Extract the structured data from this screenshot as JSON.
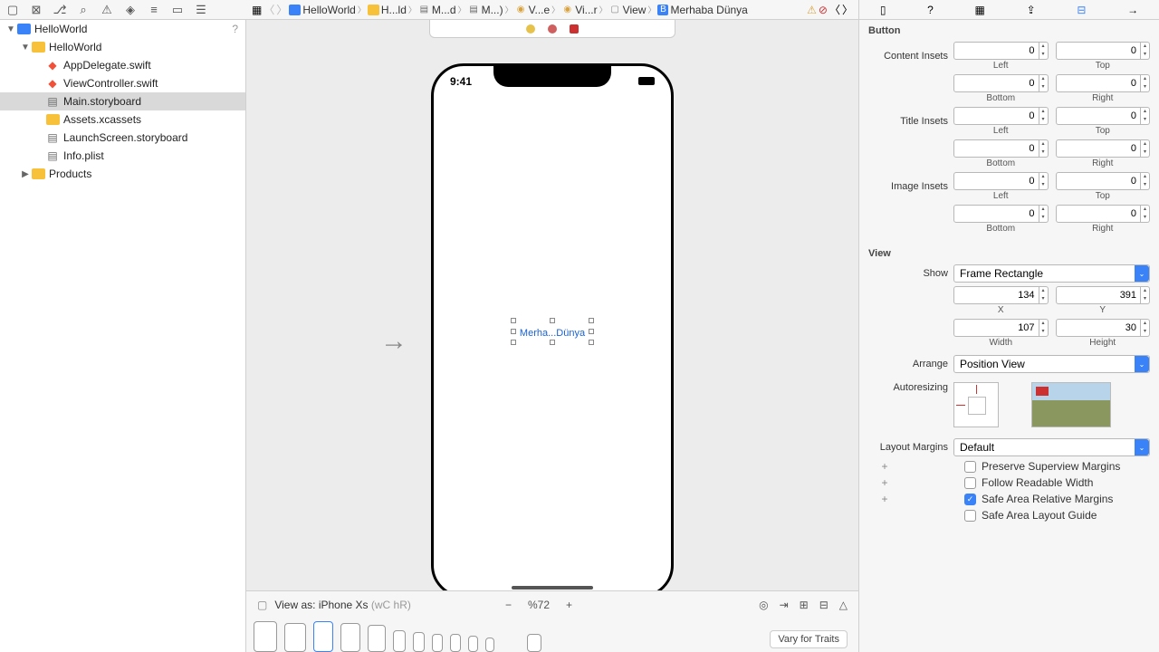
{
  "toolbar_icons": [
    "folder",
    "x-square",
    "branch",
    "search",
    "warn",
    "tag",
    "list",
    "flag",
    "chat"
  ],
  "right_icons": [
    "doc",
    "help",
    "grid",
    "pin",
    "ruler",
    "arrow"
  ],
  "jump_bar": {
    "nav_icons": [
      "grid",
      "back",
      "forward"
    ],
    "segments": [
      {
        "icon": "blue",
        "label": "HelloWorld"
      },
      {
        "icon": "yellow",
        "label": "H...ld"
      },
      {
        "icon": "sb",
        "label": "M...d"
      },
      {
        "icon": "sb",
        "label": "M...)"
      },
      {
        "icon": "scene",
        "label": "V...e"
      },
      {
        "icon": "vc",
        "label": "Vi...r"
      },
      {
        "icon": "view",
        "label": "View"
      },
      {
        "icon": "btn",
        "label": "Merhaba Dünya"
      }
    ],
    "err_icons": [
      "warn",
      "err"
    ]
  },
  "navigator": {
    "root": "HelloWorld",
    "help": "?",
    "items": [
      {
        "indent": 1,
        "icon": "yellow",
        "label": "HelloWorld",
        "disclosure": "▼"
      },
      {
        "indent": 2,
        "icon": "swift",
        "label": "AppDelegate.swift"
      },
      {
        "indent": 2,
        "icon": "swift",
        "label": "ViewController.swift"
      },
      {
        "indent": 2,
        "icon": "sb",
        "label": "Main.storyboard",
        "selected": true
      },
      {
        "indent": 2,
        "icon": "assets",
        "label": "Assets.xcassets"
      },
      {
        "indent": 2,
        "icon": "sb",
        "label": "LaunchScreen.storyboard"
      },
      {
        "indent": 2,
        "icon": "plist",
        "label": "Info.plist"
      },
      {
        "indent": 1,
        "icon": "yellow",
        "label": "Products",
        "disclosure": "▶"
      }
    ]
  },
  "canvas": {
    "time": "9:41",
    "selected_text": "Merha...Dünya"
  },
  "bottom": {
    "viewas": "View as: iPhone Xs",
    "compact": "(wC hR)",
    "zoom": "%72",
    "vary": "Vary for Traits"
  },
  "inspector": {
    "button_title": "Button",
    "content_insets_label": "Content Insets",
    "title_insets_label": "Title Insets",
    "image_insets_label": "Image Insets",
    "insets": {
      "left": "0",
      "top": "0",
      "bottom": "0",
      "right": "0"
    },
    "sub": {
      "left": "Left",
      "top": "Top",
      "bottom": "Bottom",
      "right": "Right"
    },
    "view_title": "View",
    "show_label": "Show",
    "show_value": "Frame Rectangle",
    "x": "134",
    "y": "391",
    "w": "107",
    "h": "30",
    "xl": "X",
    "yl": "Y",
    "wl": "Width",
    "hl": "Height",
    "arrange_label": "Arrange",
    "arrange_value": "Position View",
    "autoresize_label": "Autoresizing",
    "margins_label": "Layout Margins",
    "margins_value": "Default",
    "checks": [
      {
        "label": "Preserve Superview Margins",
        "checked": false,
        "plus": true
      },
      {
        "label": "Follow Readable Width",
        "checked": false,
        "plus": true
      },
      {
        "label": "Safe Area Relative Margins",
        "checked": true,
        "plus": true
      },
      {
        "label": "Safe Area Layout Guide",
        "checked": false,
        "plus": false
      }
    ]
  }
}
